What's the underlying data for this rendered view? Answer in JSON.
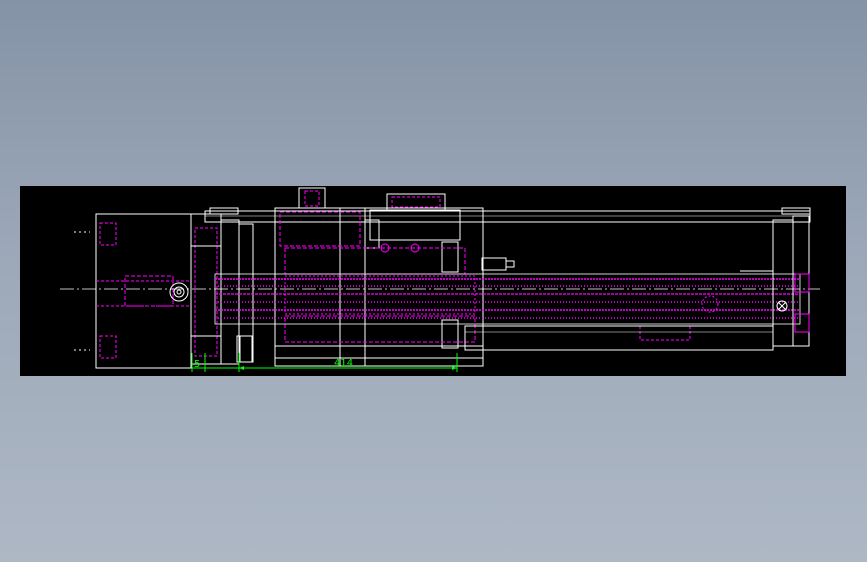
{
  "drawing": {
    "type": "cad-linear-actuator-section",
    "background": "#000000",
    "colors": {
      "outline": "#ffffff",
      "hidden": "#ff00ff",
      "dimension": "#00ff00",
      "centerline": "#ffffff"
    },
    "dimensions": {
      "left_value": "5",
      "total_value": "414"
    }
  }
}
